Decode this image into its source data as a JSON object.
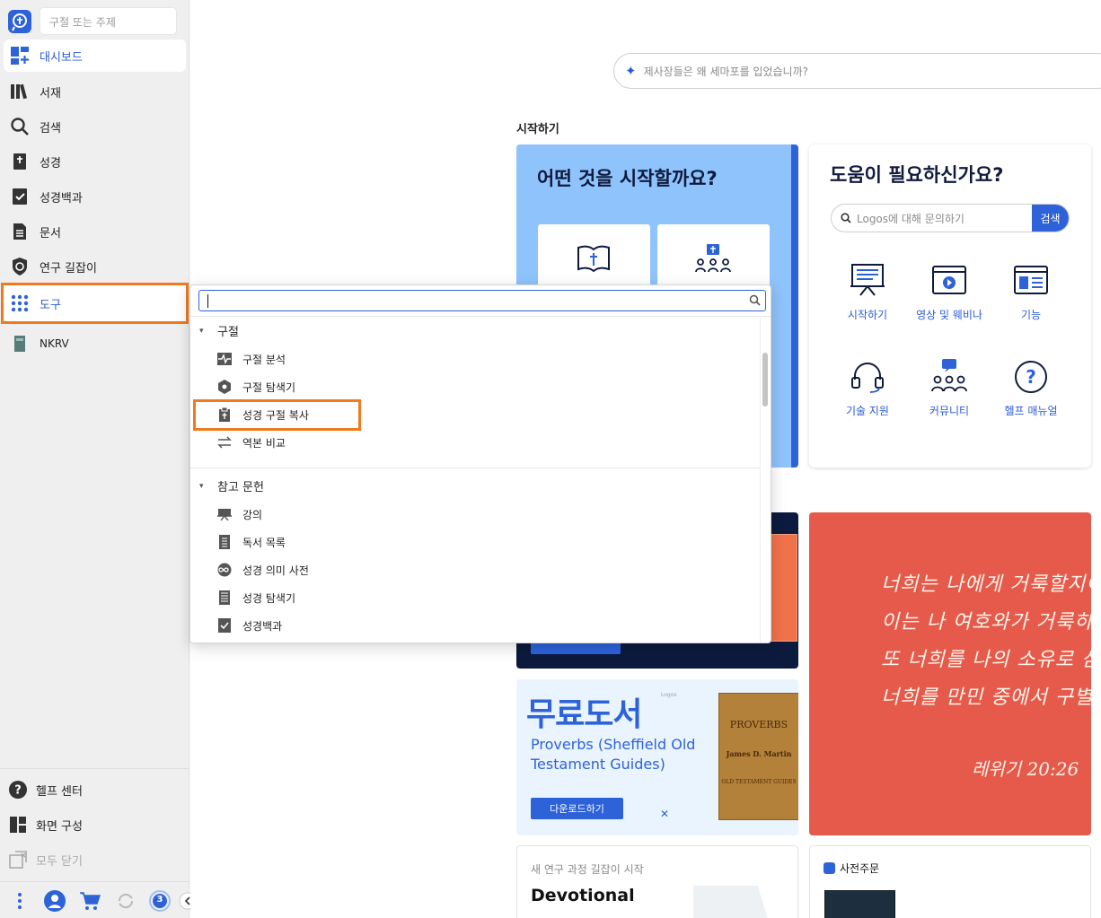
{
  "sidebar": {
    "search_placeholder": "구절 또는 주제",
    "items": [
      {
        "label": "대시보드",
        "icon": "dashboard-icon"
      },
      {
        "label": "서재",
        "icon": "library-icon"
      },
      {
        "label": "검색",
        "icon": "search-icon"
      },
      {
        "label": "성경",
        "icon": "bible-icon"
      },
      {
        "label": "성경백과",
        "icon": "factbook-icon"
      },
      {
        "label": "문서",
        "icon": "document-icon"
      },
      {
        "label": "연구 길잡이",
        "icon": "guide-icon"
      },
      {
        "label": "도구",
        "icon": "tools-grid-icon"
      },
      {
        "label": "NKRV",
        "icon": "book-icon"
      }
    ],
    "bottom": [
      {
        "label": "헬프 센터",
        "icon": "help-icon"
      },
      {
        "label": "화면 구성",
        "icon": "layout-icon"
      },
      {
        "label": "모두 닫기",
        "icon": "close-all-icon"
      }
    ],
    "footer_badge": "3"
  },
  "main": {
    "ai_search_placeholder": "제사장들은 왜 세마포를 입었습니까?",
    "section_title": "시작하기",
    "start_card": {
      "title": "어떤 것을 시작할까요?"
    },
    "help_card": {
      "title": "도움이 필요하신가요?",
      "search_placeholder": "Logos에 대해 문의하기",
      "search_button": "검색",
      "items": [
        "시작하기",
        "영상 및 웨비나",
        "기능",
        "기술 지원",
        "커뮤니티",
        "헬프 매뉴얼"
      ]
    },
    "verse_card": {
      "lines": [
        "너희는 나에게 거룩할지어다",
        "이는 나 여호와가 거룩하고",
        "또 너희를 나의 소유로 삼으",
        "너희를 만민 중에서 구별하"
      ],
      "reference": "레위기 20:26"
    },
    "free_card": {
      "heading": "무료도서",
      "title": "Proverbs (Sheffield Old Testament Guides)",
      "button": "다운로드하기",
      "book_title": "PROVERBS",
      "book_author": "James D. Martin",
      "book_series": "OLD TESTAMENT GUIDES"
    },
    "course_card": {
      "subtitle": "새 연구 과정 길잡이 시작",
      "title": "Devotional"
    },
    "preorder_card": {
      "label": "사전주문"
    }
  },
  "tools_panel": {
    "search_value": "",
    "groups": [
      {
        "label": "구절",
        "items": [
          {
            "label": "구절 분석",
            "icon": "analysis-icon"
          },
          {
            "label": "구절 탐색기",
            "icon": "explorer-icon"
          },
          {
            "label": "성경 구절 복사",
            "icon": "copy-verse-icon"
          },
          {
            "label": "역본 비교",
            "icon": "compare-icon"
          }
        ]
      },
      {
        "label": "참고 문헌",
        "items": [
          {
            "label": "강의",
            "icon": "lecture-icon"
          },
          {
            "label": "독서 목록",
            "icon": "reading-list-icon"
          },
          {
            "label": "성경 의미 사전",
            "icon": "sense-icon"
          },
          {
            "label": "성경 탐색기",
            "icon": "bible-browser-icon"
          },
          {
            "label": "성경백과",
            "icon": "factbook-icon"
          }
        ]
      }
    ]
  },
  "colors": {
    "accent": "#2e62d9",
    "highlight": "#f07a1d",
    "sidebar_bg": "#efefef"
  }
}
